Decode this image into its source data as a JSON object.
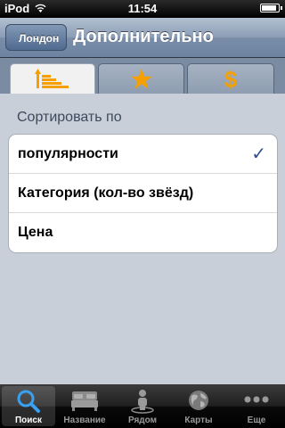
{
  "status": {
    "carrier": "iPod",
    "time": "11:54",
    "battery_level": 0.95
  },
  "navbar": {
    "back_label": "Лондон",
    "title": "Дополнительно"
  },
  "segments": [
    {
      "icon": "sort-bars-icon",
      "selected": true
    },
    {
      "icon": "star-icon",
      "selected": false
    },
    {
      "icon": "dollar-icon",
      "selected": false
    }
  ],
  "sort": {
    "header": "Сортировать по",
    "options": [
      {
        "label": "популярности",
        "checked": true
      },
      {
        "label": "Категория (кол-во звёзд)",
        "checked": false
      },
      {
        "label": "Цена",
        "checked": false
      }
    ],
    "check_glyph": "✓"
  },
  "tabs": [
    {
      "label": "Поиск",
      "icon": "search-icon",
      "active": true
    },
    {
      "label": "Название",
      "icon": "bed-icon",
      "active": false
    },
    {
      "label": "Рядом",
      "icon": "person-nearby-icon",
      "active": false
    },
    {
      "label": "Карты",
      "icon": "globe-icon",
      "active": false
    },
    {
      "label": "Еще",
      "icon": "more-icon",
      "active": false
    }
  ],
  "colors": {
    "accent_orange": "#f5a000",
    "nav_blue": "#6d83a1",
    "check_blue": "#344f88"
  }
}
